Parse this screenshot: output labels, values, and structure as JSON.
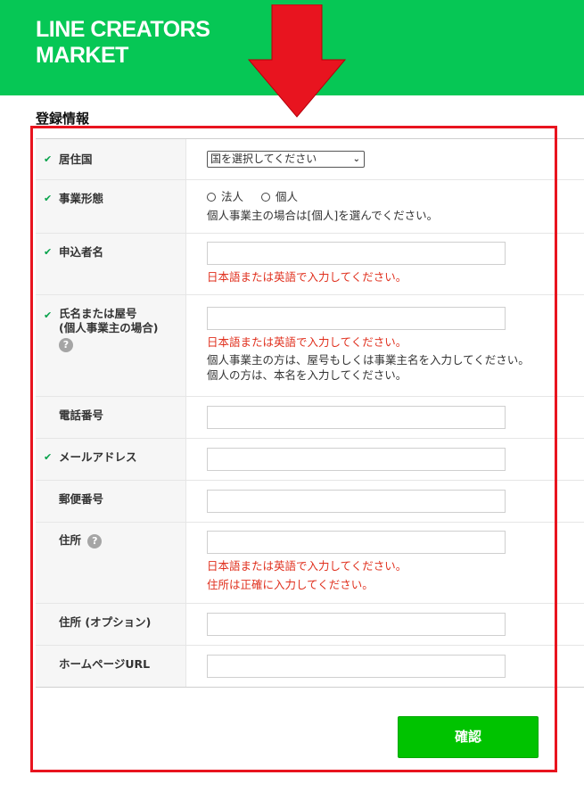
{
  "header": {
    "brand_line1": "LINE CREATORS",
    "brand_line2": "MARKET",
    "background_color": "#06c755"
  },
  "section_title": "登録情報",
  "form": {
    "country": {
      "label": "居住国",
      "required": true,
      "selected_value": "国を選択してください"
    },
    "business_type": {
      "label": "事業形態",
      "required": true,
      "option_corporate": "法人",
      "option_individual": "個人",
      "note": "個人事業主の場合は[個人]を選んでください。"
    },
    "applicant_name": {
      "label": "申込者名",
      "required": true,
      "value": "",
      "error": "日本語または英語で入力してください。"
    },
    "trade_name": {
      "label_line1": "氏名または屋号",
      "label_line2": "(個人事業主の場合)",
      "required": true,
      "value": "",
      "error": "日本語または英語で入力してください。",
      "note_line1": "個人事業主の方は、屋号もしくは事業主名を入力してください。",
      "note_line2": "個人の方は、本名を入力してください。"
    },
    "phone": {
      "label": "電話番号",
      "required": false,
      "value": ""
    },
    "email": {
      "label": "メールアドレス",
      "required": true,
      "value": ""
    },
    "postal_code": {
      "label": "郵便番号",
      "required": false,
      "value": ""
    },
    "address": {
      "label": "住所",
      "required": false,
      "value": "",
      "error_line1": "日本語または英語で入力してください。",
      "error_line2": "住所は正確に入力してください。"
    },
    "address_optional": {
      "label": "住所 (オプション)",
      "required": false,
      "value": ""
    },
    "homepage_url": {
      "label": "ホームページURL",
      "required": false,
      "value": ""
    }
  },
  "confirm_button": {
    "label": "確認",
    "color": "#00c300"
  },
  "icons": {
    "check": "✔",
    "help": "?",
    "chevron": "⌄"
  },
  "annotation": {
    "highlight_color": "#e8141f"
  }
}
